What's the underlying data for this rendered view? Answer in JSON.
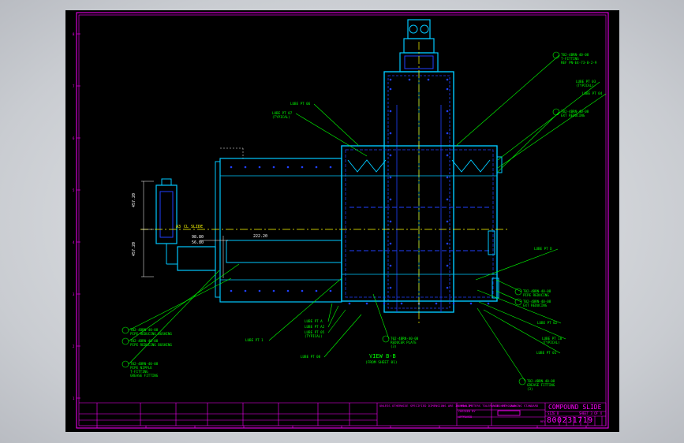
{
  "colors": {
    "background": "#000000",
    "viewport": "#d2d5da",
    "border": "#ff00ff",
    "frame": "#00c8ff",
    "detail": "#2040ff",
    "leader": "#00ff00",
    "centerline": "#ffff00",
    "text": "#00ff00"
  },
  "drawing": {
    "title": "COMPOUND SLIDE",
    "drawing_number": "800231719",
    "view_label": "VIEW B-B",
    "view_ref": "(FROM SHEET 01)",
    "sheet": "SHEET 3 OF 4",
    "size": "SIZE  B"
  },
  "dimensions": {
    "upper": "457.20",
    "lower": "457.20",
    "d1": "98.80",
    "d2": "56.80",
    "d3": "222.20",
    "axis": "A3",
    "center": "CL SLIDE"
  },
  "ruler_labels": [
    "8",
    "7",
    "6",
    "5",
    "4",
    "3",
    "2",
    "1"
  ],
  "callouts_left": [
    {
      "id": "lube-06",
      "text": "LUBE PT 06"
    },
    {
      "id": "lube-07",
      "text": "LUBE PT 07\n(TYPICAL)"
    },
    {
      "id": "lube-a",
      "text": "LUBE PT  A"
    },
    {
      "id": "lube-a2",
      "text": "LUBE PT  A2"
    },
    {
      "id": "lube-05",
      "text": "LUBE PT 05\n(TYPICAL)"
    },
    {
      "id": "lube-1",
      "text": "LUBE PT  1"
    },
    {
      "id": "lube-08",
      "text": "LUBE PT  08"
    },
    {
      "id": "part-l1",
      "text": "T02-4BRN-40-08\nPIPE REDUCING BUSHING"
    },
    {
      "id": "part-l2",
      "text": "T02-4BRN-40-08\nPIPE REDUCING BUSHING"
    },
    {
      "id": "part-l3",
      "text": "T02-4BRN-40-08\nPIPE NIPPLE\nT-FITTING\nGREASE FITTING"
    }
  ],
  "callouts_right": [
    {
      "id": "part-r1",
      "text": "T02-4BRN-40-08\nT-FITTING\nREF PN-E4-73-0-2-9"
    },
    {
      "id": "lube-03",
      "text": "LUBE PT 03\n(TYPICAL)"
    },
    {
      "id": "lube-04",
      "text": "LUBE PT  04"
    },
    {
      "id": "part-r2",
      "text": "T02-4BRN-40-08\nEXT REDUCING"
    },
    {
      "id": "lube-d",
      "text": "LUBE PT  D"
    },
    {
      "id": "part-r3",
      "text": "T02-4BRN-40-08\nPIPE REDUCING"
    },
    {
      "id": "part-r4",
      "text": "T02-4BRN-40-08\nEXT REDUCING"
    },
    {
      "id": "lube-02",
      "text": "LUBE PT  02"
    },
    {
      "id": "lube-10",
      "text": "LUBE PT 10\n(TYPICAL)"
    },
    {
      "id": "lube-01",
      "text": "LUBE PT  01"
    },
    {
      "id": "part-bot",
      "text": "T02-4BRN-40-08\nREDUCER PLATE\n(3)"
    },
    {
      "id": "part-r5",
      "text": "T02-4BRN-40-08\nGREASE FITTING\n(3)"
    }
  ],
  "title_block": {
    "notes": "UNLESS OTHERWISE SPECIFIED DIMENSIONS ARE IN MILLIMETERS TOLERANCES PER DRAWING STANDARD",
    "drawn": "DRAWN BY",
    "checked": "CHECKED BY",
    "approved": "APPROVED",
    "company": "DO NOT SCALE",
    "rev": "REV"
  }
}
